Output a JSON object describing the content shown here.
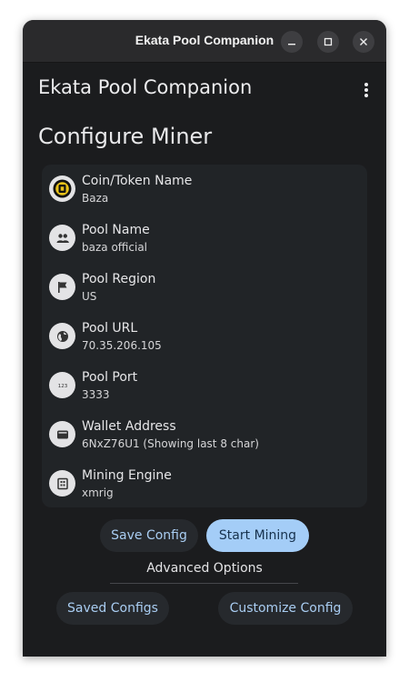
{
  "window": {
    "title": "Ekata Pool Companion"
  },
  "appbar": {
    "title": "Ekata Pool Companion"
  },
  "page": {
    "title": "Configure Miner"
  },
  "config": {
    "items": [
      {
        "label": "Coin/Token Name",
        "value": "Baza",
        "icon": "coin-logo-icon"
      },
      {
        "label": "Pool Name",
        "value": "baza official",
        "icon": "group-icon"
      },
      {
        "label": "Pool Region",
        "value": "US",
        "icon": "flag-icon"
      },
      {
        "label": "Pool URL",
        "value": "70.35.206.105",
        "icon": "globe-icon"
      },
      {
        "label": "Pool Port",
        "value": "3333",
        "icon": "number-icon"
      },
      {
        "label": "Wallet Address",
        "value": "6NxZ76U1 (Showing last 8 char)",
        "icon": "wallet-icon"
      },
      {
        "label": "Mining Engine",
        "value": "xmrig",
        "icon": "chip-icon"
      }
    ]
  },
  "actions": {
    "save_config": "Save Config",
    "start_mining": "Start Mining",
    "advanced_title": "Advanced Options",
    "saved_configs": "Saved Configs",
    "customize_config": "Customize Config"
  },
  "icons": {
    "number_text": "123"
  },
  "colors": {
    "window_bg": "#1b1c1e",
    "card_bg": "#212427",
    "accent": "#a4cdf7",
    "tonal_text": "#a9cdf2"
  }
}
